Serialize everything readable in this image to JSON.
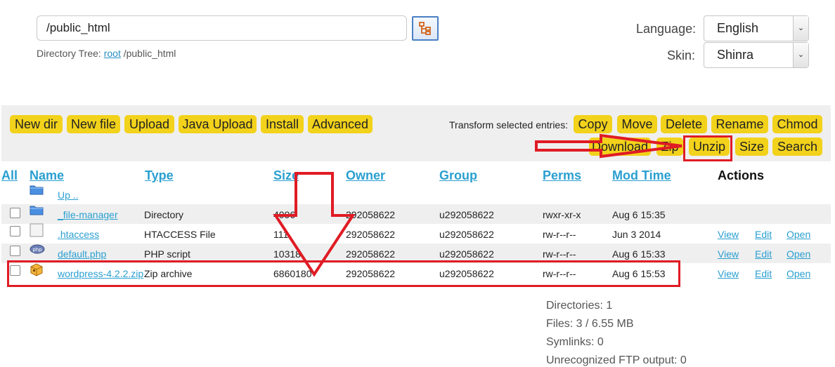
{
  "path": {
    "value": "/public_html"
  },
  "directory_tree": {
    "label": "Directory Tree:",
    "root_link": "root",
    "path": "/public_html"
  },
  "settings": {
    "language_label": "Language:",
    "language_value": "English",
    "skin_label": "Skin:",
    "skin_value": "Shinra"
  },
  "toolbar": {
    "left_buttons": [
      "New dir",
      "New file",
      "Upload",
      "Java Upload",
      "Install",
      "Advanced"
    ],
    "transform_label": "Transform selected entries:",
    "transform_row1": [
      "Copy",
      "Move",
      "Delete",
      "Rename",
      "Chmod"
    ],
    "transform_row2": [
      "Download",
      "Zip",
      "Unzip",
      "Size",
      "Search"
    ],
    "button_color": "#f2d21b"
  },
  "table": {
    "headers": [
      "All",
      "Name",
      "Type",
      "Size",
      "Owner",
      "Group",
      "Perms",
      "Mod Time",
      "Actions"
    ],
    "up_label": "Up ..",
    "rows": [
      {
        "icon": "folder-icon",
        "name": "_file-manager",
        "type": "Directory",
        "size": "4096",
        "owner": "292058622",
        "group": "u292058622",
        "perms": "rwxr-xr-x",
        "mtime": "Aug 6 15:35",
        "actions": []
      },
      {
        "icon": "blank-file-icon",
        "name": ".htaccess",
        "type": "HTACCESS File",
        "size": "111",
        "owner": "292058622",
        "group": "u292058622",
        "perms": "rw-r--r--",
        "mtime": "Jun 3 2014",
        "actions": [
          "View",
          "Edit",
          "Open"
        ]
      },
      {
        "icon": "php-file-icon",
        "name": "default.php",
        "type": "PHP script",
        "size": "10318",
        "owner": "292058622",
        "group": "u292058622",
        "perms": "rw-r--r--",
        "mtime": "Aug 6 15:33",
        "actions": [
          "View",
          "Edit",
          "Open"
        ]
      },
      {
        "icon": "zip-archive-icon",
        "name": "wordpress-4.2.2.zip",
        "type": "Zip archive",
        "size": "6860180",
        "owner": "292058622",
        "group": "u292058622",
        "perms": "rw-r--r--",
        "mtime": "Aug 6 15:53",
        "actions": [
          "View",
          "Edit",
          "Open"
        ]
      }
    ]
  },
  "summary": {
    "directories": "Directories: 1",
    "files": "Files: 3 / 6.55 MB",
    "symlinks": "Symlinks: 0",
    "unrecognized": "Unrecognized FTP output: 0"
  },
  "colors": {
    "accent_link": "#2a9fd0",
    "annotation_red": "#e01b24"
  }
}
